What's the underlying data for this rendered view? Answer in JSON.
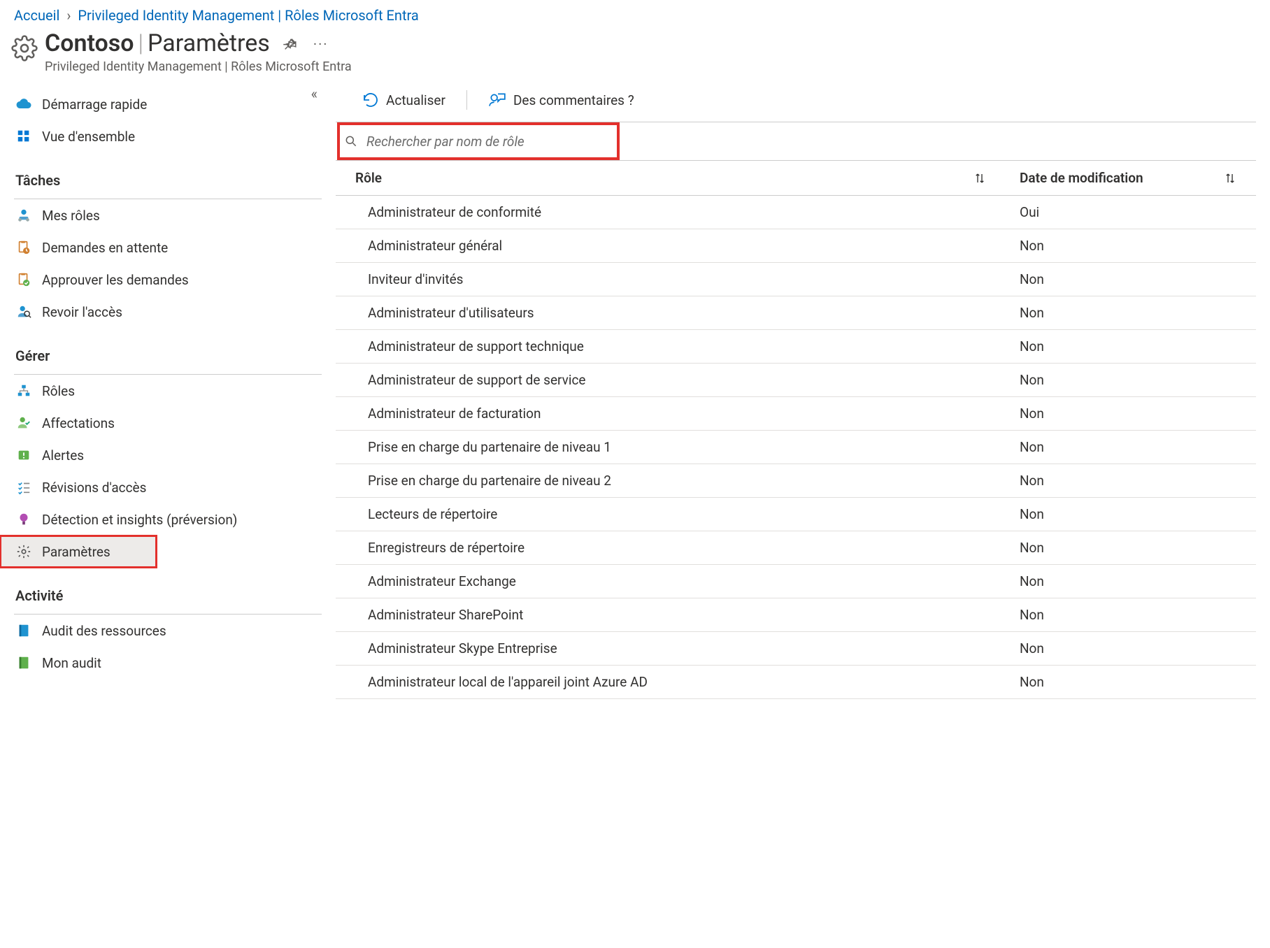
{
  "breadcrumb": {
    "home": "Accueil",
    "current": "Privileged Identity Management | Rôles Microsoft Entra"
  },
  "header": {
    "tenant": "Contoso",
    "page": "Paramètres",
    "subtitle": "Privileged Identity Management | Rôles Microsoft Entra"
  },
  "toolbar": {
    "refresh": "Actualiser",
    "feedback": "Des commentaires ?"
  },
  "search": {
    "placeholder": "Rechercher par nom de rôle"
  },
  "sidebar": {
    "quickstart": "Démarrage rapide",
    "overview": "Vue d'ensemble",
    "sections": {
      "tasks": "Tâches",
      "manage": "Gérer",
      "activity": "Activité"
    },
    "tasks": {
      "my_roles": "Mes rôles",
      "pending_requests": "Demandes en attente",
      "approve_requests": "Approuver les demandes",
      "review_access": "Revoir l'accès"
    },
    "manage": {
      "roles": "Rôles",
      "assignments": "Affectations",
      "alerts": "Alertes",
      "access_reviews": "Révisions d'accès",
      "detection": "Détection et insights (préversion)",
      "settings": "Paramètres"
    },
    "activity": {
      "resource_audit": "Audit des ressources",
      "my_audit": "Mon audit"
    }
  },
  "table": {
    "columns": {
      "role": "Rôle",
      "modified": "Date de modification"
    },
    "rows": [
      {
        "role": "Administrateur de conformité",
        "modified": "Oui"
      },
      {
        "role": "Administrateur général",
        "modified": "Non"
      },
      {
        "role": "Inviteur d'invités",
        "modified": "Non"
      },
      {
        "role": "Administrateur d'utilisateurs",
        "modified": "Non"
      },
      {
        "role": "Administrateur de support technique",
        "modified": "Non"
      },
      {
        "role": "Administrateur de support de service",
        "modified": "Non"
      },
      {
        "role": "Administrateur de facturation",
        "modified": "Non"
      },
      {
        "role": "Prise en charge du partenaire de niveau 1",
        "modified": "Non"
      },
      {
        "role": "Prise en charge du partenaire de niveau 2",
        "modified": "Non"
      },
      {
        "role": "Lecteurs de répertoire",
        "modified": "Non"
      },
      {
        "role": "Enregistreurs de répertoire",
        "modified": "Non"
      },
      {
        "role": "Administrateur Exchange",
        "modified": "Non"
      },
      {
        "role": "Administrateur SharePoint",
        "modified": "Non"
      },
      {
        "role": "Administrateur Skype Entreprise",
        "modified": "Non"
      },
      {
        "role": "Administrateur local de l'appareil joint Azure AD",
        "modified": "Non"
      }
    ]
  }
}
